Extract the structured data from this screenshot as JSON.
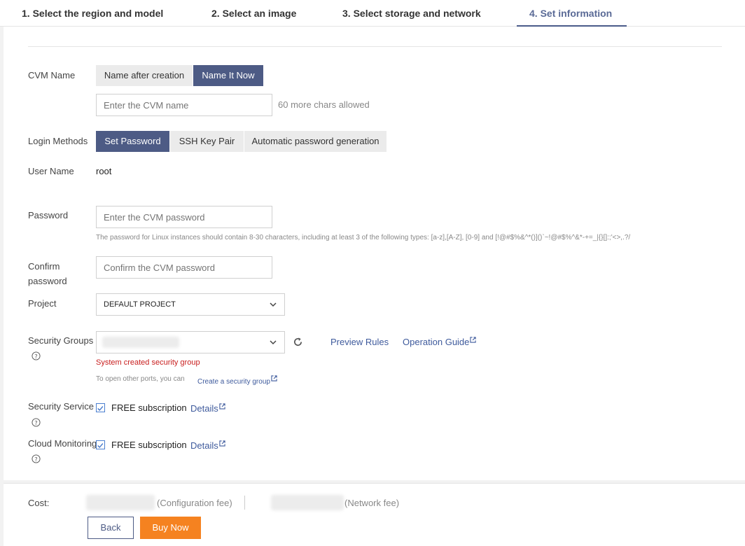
{
  "steps": [
    {
      "label": "1. Select the region and model"
    },
    {
      "label": "2. Select an image"
    },
    {
      "label": "3. Select storage and network"
    },
    {
      "label": "4. Set information"
    }
  ],
  "cvm_name": {
    "label": "CVM Name",
    "options": [
      "Name after creation",
      "Name It Now"
    ],
    "selected": "Name It Now",
    "placeholder": "Enter the CVM name",
    "chars_hint": "60 more chars allowed"
  },
  "login": {
    "label": "Login Methods",
    "options": [
      "Set Password",
      "SSH Key Pair",
      "Automatic password generation"
    ],
    "selected": "Set Password"
  },
  "user_name": {
    "label": "User Name",
    "value": "root"
  },
  "password": {
    "label": "Password",
    "placeholder": "Enter the CVM password",
    "rule": "The password for Linux instances should contain 8-30 characters, including at least 3 of the following types: [a-z],[A-Z], [0-9] and [!@#$%&^*()]()`~!@#$%^&*-+=_|{}[]:;'<>,.?/"
  },
  "confirm": {
    "label_line1": "Confirm",
    "label_line2": "password",
    "placeholder": "Confirm the CVM password"
  },
  "project": {
    "label": "Project",
    "value": "DEFAULT PROJECT"
  },
  "security_groups": {
    "label": "Security Groups",
    "preview": "Preview Rules",
    "guide": "Operation Guide",
    "note": "System created security group",
    "other_ports": "To open other ports, you can",
    "create_link": "Create a security group"
  },
  "security_service": {
    "label": "Security Service",
    "text": "FREE subscription",
    "details": "Details",
    "checked": true
  },
  "cloud_monitoring": {
    "label": "Cloud Monitoring",
    "text": "FREE subscription",
    "details": "Details",
    "checked": true
  },
  "cost": {
    "label": "Cost:",
    "config_fee": "(Configuration fee)",
    "network_fee": "(Network fee)"
  },
  "actions": {
    "back": "Back",
    "buy": "Buy Now"
  },
  "colors": {
    "primary": "#4d5b85",
    "link": "#3e5a9c",
    "accent": "#f58220",
    "error": "#c81d1d"
  }
}
